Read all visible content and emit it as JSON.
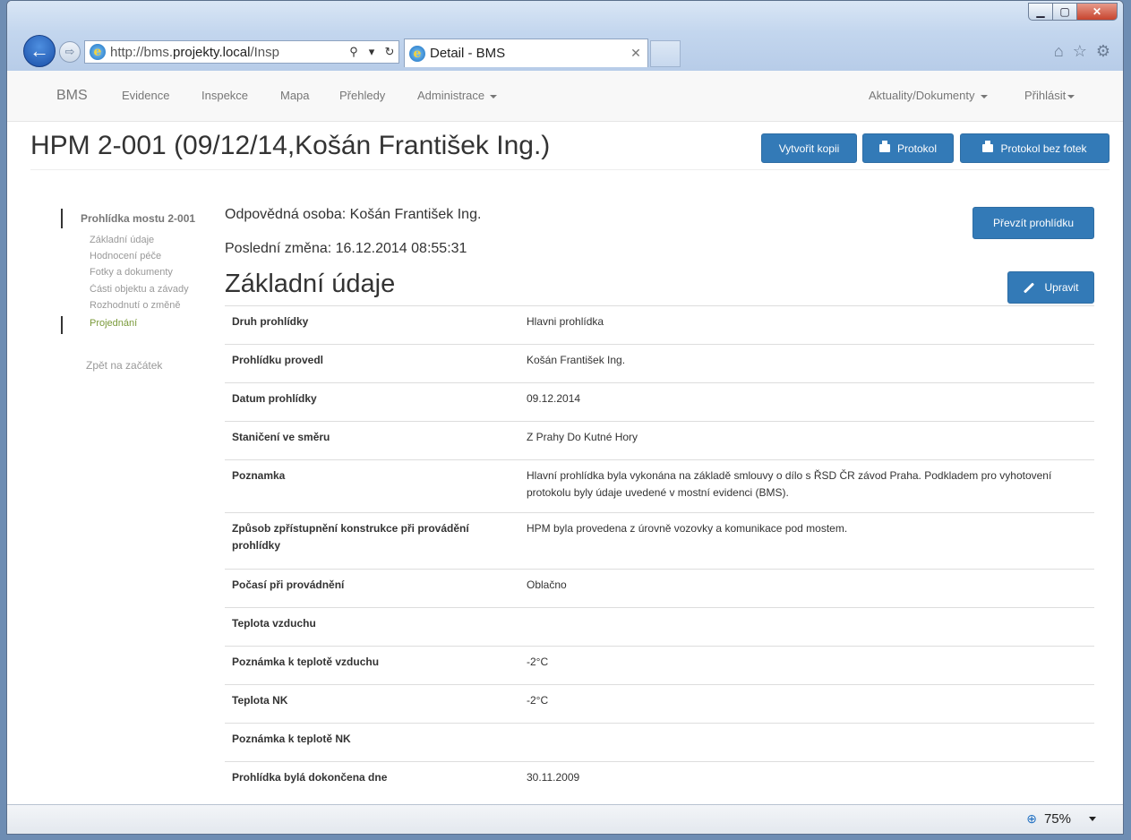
{
  "browser": {
    "address_scheme": "http://bms.",
    "address_domain": "projekty.local",
    "address_path": "/Insp",
    "tab_title": "Detail - BMS",
    "zoom": "75%"
  },
  "navbar": {
    "brand": "BMS",
    "items": [
      "Evidence",
      "Inspekce",
      "Mapa",
      "Přehledy",
      "Administrace"
    ],
    "right": [
      "Aktuality/Dokumenty",
      "Přihlásit"
    ]
  },
  "page": {
    "title": "HPM 2-001 (09/12/14,Košán František Ing.)",
    "buttons": {
      "copy": "Vytvořit kopii",
      "protocol": "Protokol",
      "protocol_no_photos": "Protokol bez fotek",
      "take_over": "Převzít prohlídku",
      "edit": "Upravit"
    },
    "responsible": "Odpovědná osoba: Košán František Ing.",
    "last_change": "Poslední změna: 16.12.2014 08:55:31",
    "section_title": "Základní údaje"
  },
  "sidebar": {
    "main": "Prohlídka mostu 2-001",
    "items": [
      "Základní údaje",
      "Hodnocení péče",
      "Fotky a dokumenty",
      "Části objektu a závady",
      "Rozhodnutí o změně",
      "Projednání"
    ],
    "back": "Zpět na začátek"
  },
  "details": [
    {
      "key": "Druh prohlídky",
      "value": "Hlavni prohlídka"
    },
    {
      "key": "Prohlídku provedl",
      "value": "Košán František Ing."
    },
    {
      "key": "Datum prohlídky",
      "value": "09.12.2014"
    },
    {
      "key": "Staničení ve směru",
      "value": "Z Prahy Do Kutné Hory"
    },
    {
      "key": "Poznamka",
      "value": "Hlavní prohlídka byla vykonána na základě smlouvy o dílo s ŘSD ČR závod Praha. Podkladem pro vyhotovení protokolu byly údaje uvedené v mostní evidenci (BMS)."
    },
    {
      "key": "Způsob zpřístupnění konstrukce při provádění prohlídky",
      "value": "HPM byla provedena z úrovně vozovky a komunikace pod mostem."
    },
    {
      "key": "Počasí při provádnění",
      "value": "Oblačno"
    },
    {
      "key": "Teplota vzduchu",
      "value": ""
    },
    {
      "key": "Poznámka k teplotě vzduchu",
      "value": "-2°C"
    },
    {
      "key": "Teplota NK",
      "value": "-2°C"
    },
    {
      "key": "Poznámka k teplotě NK",
      "value": ""
    },
    {
      "key": "Prohlídka bylá dokončena dne",
      "value": "30.11.2009"
    }
  ]
}
